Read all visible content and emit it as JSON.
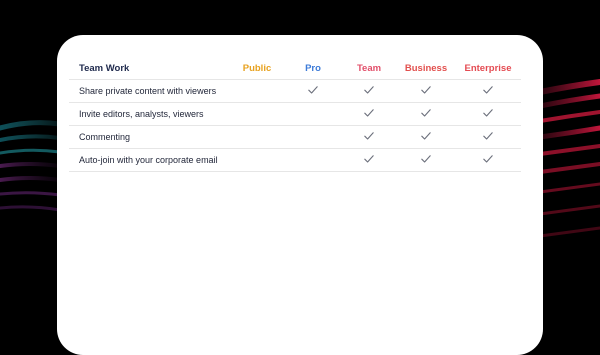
{
  "table": {
    "section_title": "Team Work",
    "plans": [
      {
        "label": "Public",
        "color": "#e8a21f"
      },
      {
        "label": "Pro",
        "color": "#3d7bd8"
      },
      {
        "label": "Team",
        "color": "#e24f6a"
      },
      {
        "label": "Business",
        "color": "#e2504e"
      },
      {
        "label": "Enterprise",
        "color": "#e44b52"
      }
    ],
    "rows": [
      {
        "feature": "Share private content with viewers",
        "checks": [
          false,
          true,
          true,
          true,
          true
        ]
      },
      {
        "feature": "Invite editors, analysts, viewers",
        "checks": [
          false,
          false,
          true,
          true,
          true
        ]
      },
      {
        "feature": "Commenting",
        "checks": [
          false,
          false,
          true,
          true,
          true
        ]
      },
      {
        "feature": "Auto-join with your corporate email",
        "checks": [
          false,
          false,
          true,
          true,
          true
        ]
      }
    ],
    "check_icon": "checkmark-icon",
    "check_color": "#6b6f7b"
  }
}
